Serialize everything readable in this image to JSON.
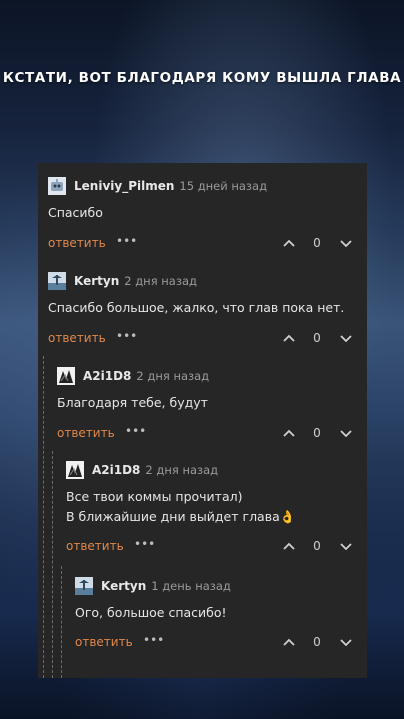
{
  "caption": "Кстати, вот благодаря кому вышла глава",
  "comments": [
    {
      "user": "Leniviy_Pilmen",
      "time": "15 дней назад",
      "lines": [
        "Спасибо"
      ],
      "reply": "ответить",
      "score": "0",
      "avatar_icon": "robot-avatar-icon"
    },
    {
      "user": "Kertyn",
      "time": "2 дня назад",
      "lines": [
        "Спасибо большое, жалко, что глав пока нет."
      ],
      "reply": "ответить",
      "score": "0",
      "avatar_icon": "landscape-avatar-icon"
    },
    {
      "user": "A2i1D8",
      "time": "2 дня назад",
      "lines": [
        "Благодаря тебе, будут"
      ],
      "reply": "ответить",
      "score": "0",
      "avatar_icon": "manga-avatar-icon"
    },
    {
      "user": "A2i1D8",
      "time": "2 дня назад",
      "lines": [
        "Все твои коммы прочитал)",
        "В ближайшие дни выйдет глава👌"
      ],
      "reply": "ответить",
      "score": "0",
      "avatar_icon": "manga-avatar-icon"
    },
    {
      "user": "Kertyn",
      "time": "1 день назад",
      "lines": [
        "Ого, большое спасибо!"
      ],
      "reply": "ответить",
      "score": "0",
      "avatar_icon": "landscape-avatar-icon"
    }
  ],
  "colors": {
    "panel": "#262626",
    "reply_accent": "#e0884a",
    "text": "#e6e6e6",
    "muted": "#9a9a9a"
  }
}
